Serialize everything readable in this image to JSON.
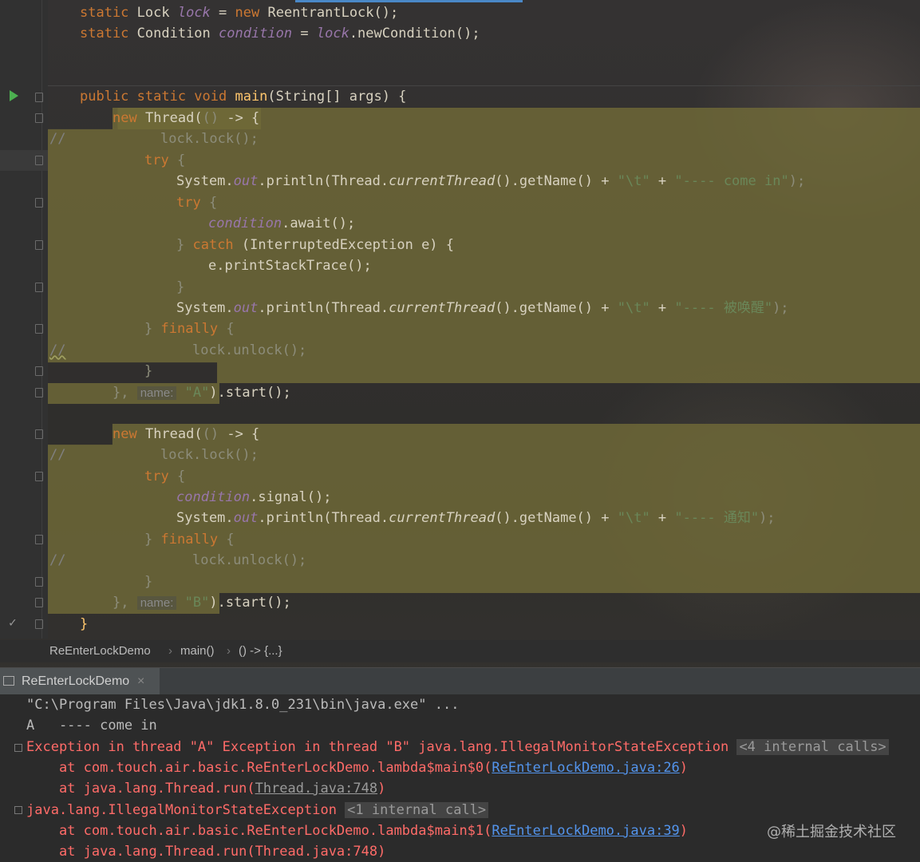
{
  "editor": {
    "lines": {
      "l1": {
        "a": "static ",
        "b": "Lock ",
        "c": "lock",
        "d": " = ",
        "e": "new ",
        "f": "ReentrantLock();"
      },
      "l2": {
        "a": "static ",
        "b": "Condition ",
        "c": "condition",
        "d": " = ",
        "e": "lock",
        ".f": "",
        "f": ".newCondition();"
      },
      "l3": {
        "a": "public static void ",
        "b": "main",
        "c": "(String[] args) {"
      },
      "l4": {
        "a": "new ",
        "b": "Thread(",
        "c": "()",
        "d": " -> {"
      },
      "l5": {
        "cm": "//",
        "a": "lock.lock();"
      },
      "l6": {
        "a": "try ",
        "b": "{"
      },
      "l7": {
        "a": "System.",
        "b": "out",
        ".c": "",
        "c": ".println(Thread.",
        "d": "currentThread",
        "e": "().getName() + ",
        "f": "\"\\t\"",
        "g": " + ",
        "h": "\"---- come in\"",
        "i": ");"
      },
      "l8": {
        "a": "try ",
        "b": "{"
      },
      "l9": {
        "a": "condition",
        "b": ".await();"
      },
      "l10": {
        "a": "} ",
        "b": "catch ",
        "c": "(InterruptedException e) {"
      },
      "l11": {
        "a": "e.printStackTrace();"
      },
      "l12": {
        "a": "}"
      },
      "l13": {
        "a": "System.",
        "b": "out",
        "c": ".println(Thread.",
        "d": "currentThread",
        "e": "().getName() + ",
        "f": "\"\\t\"",
        "g": " + ",
        "h": "\"---- 被唤醒\"",
        "i": ");"
      },
      "l14": {
        "a": "} ",
        "b": "finally ",
        "c": "{"
      },
      "l15": {
        "cm": "//",
        "a": "lock.unlock();"
      },
      "l16": {
        "a": "}"
      },
      "l17": {
        "a": "}, ",
        "hint": "name:",
        "s": "\"A\"",
        "b": ").start();"
      },
      "l18": {
        "a": "new ",
        "b": "Thread(",
        "c": "()",
        "d": " -> {"
      },
      "l19": {
        "cm": "//",
        "a": "lock.lock();"
      },
      "l20": {
        "a": "try ",
        "b": "{"
      },
      "l21": {
        "a": "condition",
        "b": ".signal();"
      },
      "l22": {
        "a": "System.",
        "b": "out",
        "c": ".println(Thread.",
        "d": "currentThread",
        "e": "().getName() + ",
        "f": "\"\\t\"",
        "g": " + ",
        "h": "\"---- 通知\"",
        "i": ");"
      },
      "l23": {
        "a": "} ",
        "b": "finally ",
        "c": "{"
      },
      "l24": {
        "cm": "//",
        "a": "lock.unlock();"
      },
      "l25": {
        "a": "}"
      },
      "l26": {
        "a": "}, ",
        "hint": "name:",
        "s": "\"B\"",
        "b": ").start();"
      },
      "l27": {
        "a": "}"
      }
    }
  },
  "breadcrumb": {
    "class": "ReEnterLockDemo",
    "method": "main()",
    "lambda": "() -> {...}"
  },
  "run_panel": {
    "tab_label": "ReEnterLockDemo",
    "close": "×"
  },
  "console": {
    "c1": "\"C:\\Program Files\\Java\\jdk1.8.0_231\\bin\\java.exe\" ...",
    "c2": "A   ---- come in",
    "c3a": "Exception in thread \"A\" Exception in thread \"B\" java.lang.IllegalMonitorStateException ",
    "c3b": "<4 internal calls>",
    "c4a": "    at com.touch.air.basic.ReEnterLockDemo.lambda$main$0(",
    "c4l": "ReEnterLockDemo.java:26",
    "c4c": ")",
    "c5a": "    at java.lang.Thread.run(",
    "c5l": "Thread.java:748",
    "c5c": ")",
    "c6a": "java.lang.IllegalMonitorStateException ",
    "c6b": "<1 internal call>",
    "c7a": "    at com.touch.air.basic.ReEnterLockDemo.lambda$main$1(",
    "c7l": "ReEnterLockDemo.java:39",
    "c7c": ")",
    "c8a": "    at java.lang.Thread.run(Thread.java:748)"
  },
  "watermark": "@稀土掘金技术社区"
}
